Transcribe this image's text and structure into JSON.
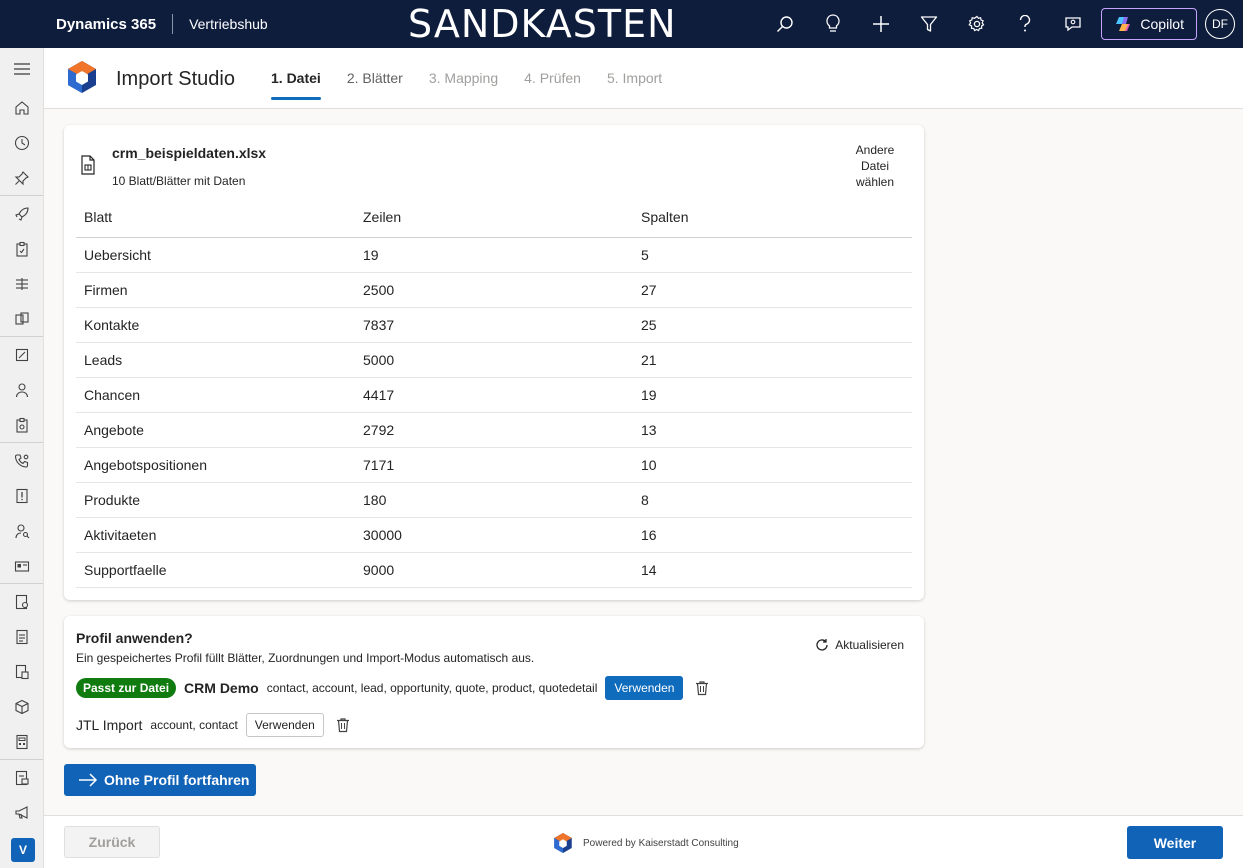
{
  "topbar": {
    "brand": "Dynamics 365",
    "hub": "Vertriebshub",
    "environment": "SANDKASTEN",
    "copilot_label": "Copilot",
    "avatar_initials": "DF"
  },
  "nav": {
    "bottom_badge": "V"
  },
  "header": {
    "app_title": "Import Studio",
    "steps": [
      "1. Datei",
      "2. Blätter",
      "3. Mapping",
      "4. Prüfen",
      "5. Import"
    ],
    "active_step": 0
  },
  "file": {
    "name": "crm_beispieldaten.xlsx",
    "summary": "10 Blatt/Blätter mit Daten",
    "other_file_label": "Andere Datei wählen",
    "columns": [
      "Blatt",
      "Zeilen",
      "Spalten"
    ],
    "rows": [
      [
        "Uebersicht",
        "19",
        "5"
      ],
      [
        "Firmen",
        "2500",
        "27"
      ],
      [
        "Kontakte",
        "7837",
        "25"
      ],
      [
        "Leads",
        "5000",
        "21"
      ],
      [
        "Chancen",
        "4417",
        "19"
      ],
      [
        "Angebote",
        "2792",
        "13"
      ],
      [
        "Angebotspositionen",
        "7171",
        "10"
      ],
      [
        "Produkte",
        "180",
        "8"
      ],
      [
        "Aktivitaeten",
        "30000",
        "16"
      ],
      [
        "Supportfaelle",
        "9000",
        "14"
      ]
    ]
  },
  "profile": {
    "title": "Profil anwenden?",
    "subtitle": "Ein gespeichertes Profil füllt Blätter, Zuordnungen und Import-Modus automatisch aus.",
    "refresh_label": "Aktualisieren",
    "profiles": [
      {
        "badge": "Passt zur Datei",
        "name": "CRM Demo",
        "entities": "contact, account, lead, opportunity, quote, product, quotedetail",
        "use_label": "Verwenden"
      },
      {
        "name": "JTL Import",
        "entities": "account, contact",
        "use_label": "Verwenden"
      }
    ]
  },
  "continue_label": "Ohne Profil fortfahren",
  "footer": {
    "back_label": "Zurück",
    "powered_by": "Powered by Kaiserstadt Consulting",
    "next_label": "Weiter"
  },
  "colors": {
    "topbar": "#0f1d3d",
    "primary": "#1163b8",
    "success": "#107c10"
  }
}
